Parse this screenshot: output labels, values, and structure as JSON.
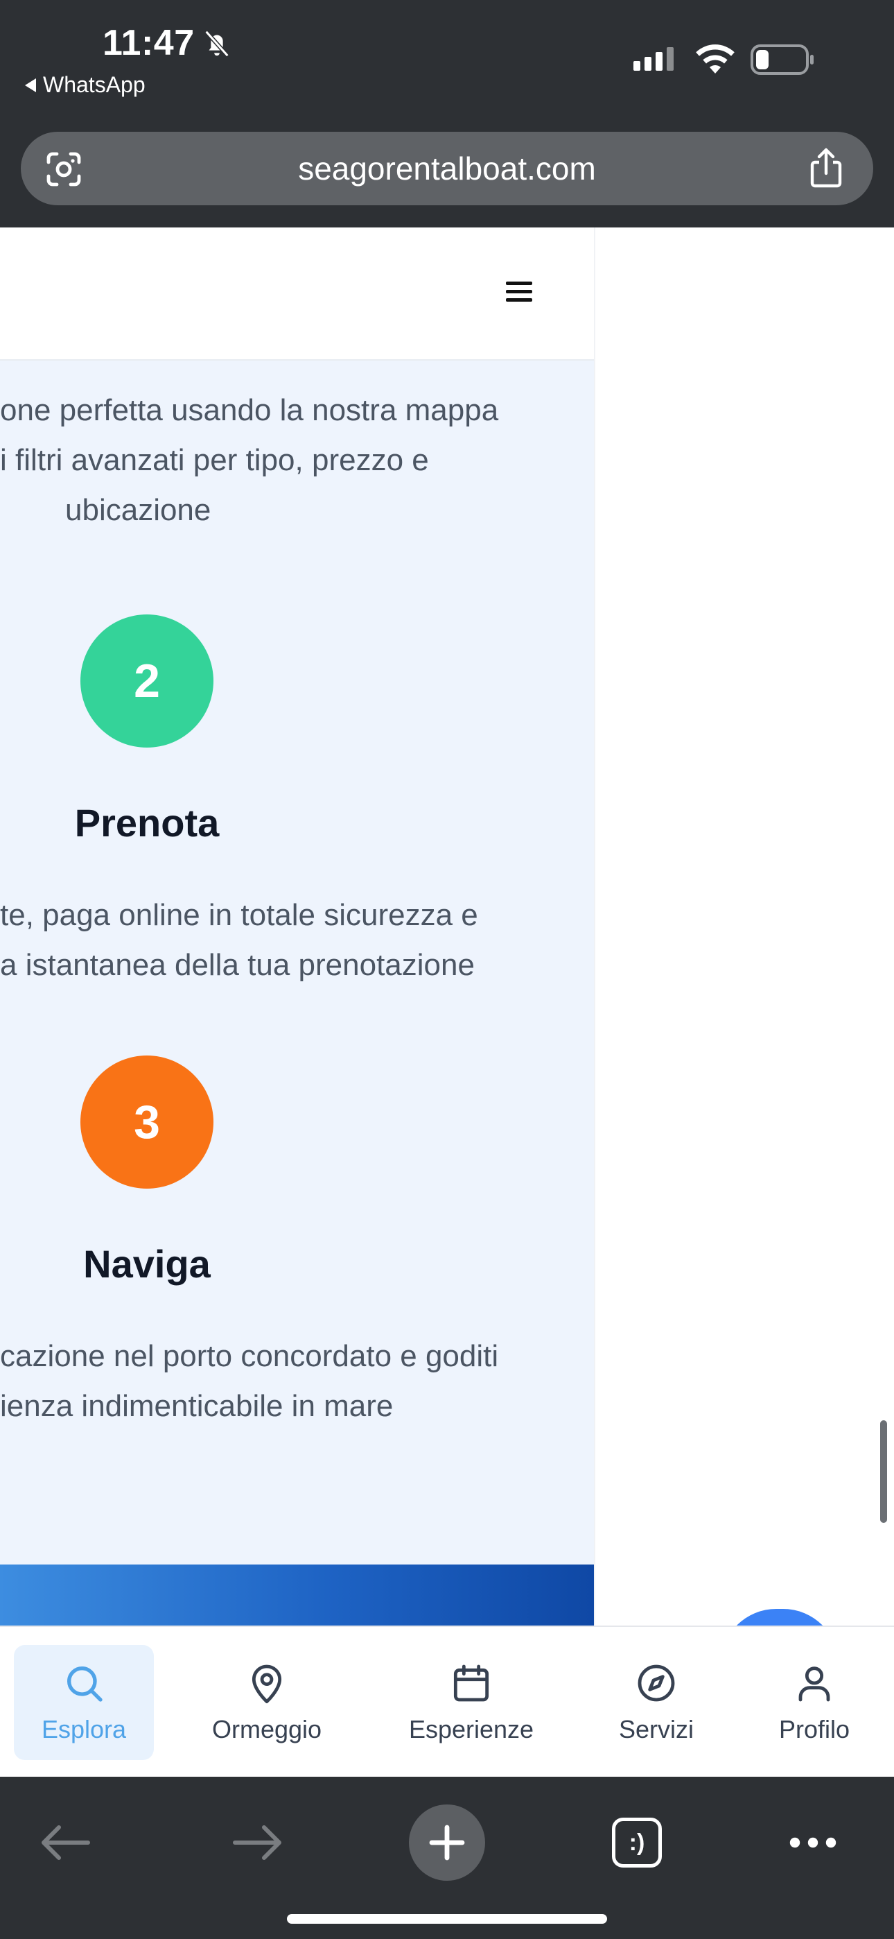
{
  "status_bar": {
    "time": "11:47",
    "back_app": "WhatsApp"
  },
  "browser": {
    "url": "seagorentalboat.com"
  },
  "steps": [
    {
      "number": "",
      "title": "",
      "desc_lines": [
        "one perfetta usando la nostra mappa",
        "i filtri avanzati per tipo, prezzo e",
        "ubicazione"
      ]
    },
    {
      "number": "2",
      "title": "Prenota",
      "color": "#34d399",
      "desc_lines": [
        "te, paga online in totale sicurezza e",
        "a istantanea della tua prenotazione"
      ]
    },
    {
      "number": "3",
      "title": "Naviga",
      "color": "#f97316",
      "desc_lines": [
        "cazione nel porto concordato e goditi",
        "ienza indimenticabile in mare"
      ]
    }
  ],
  "bottom_nav": [
    {
      "label": "Esplora",
      "icon": "search-icon",
      "active": true
    },
    {
      "label": "Ormeggio",
      "icon": "map-pin-icon",
      "active": false
    },
    {
      "label": "Esperienze",
      "icon": "calendar-icon",
      "active": false
    },
    {
      "label": "Servizi",
      "icon": "compass-icon",
      "active": false
    },
    {
      "label": "Profilo",
      "icon": "user-icon",
      "active": false
    }
  ],
  "toolbar": {
    "tabs_glyph": ":)"
  },
  "colors": {
    "accent": "#4fa3e8",
    "step2": "#34d399",
    "step3": "#f97316",
    "section_bg": "#eef4fd"
  }
}
